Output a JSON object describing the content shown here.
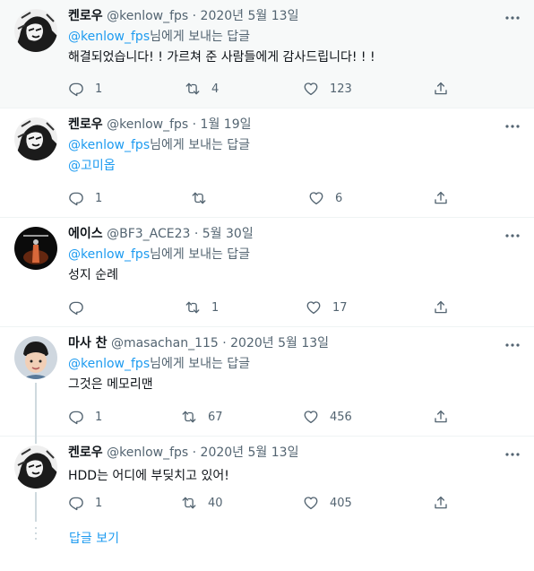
{
  "tweets": [
    {
      "name": "켄로우",
      "meta": "@kenlow_fps · 2020년 5월 13일",
      "reply_prefix": "@kenlow_fps",
      "reply_suffix": "님에게 보내는 답글",
      "text": "해결되었습니다! ! 가르쳐 준 사람들에게 감사드립니다! ! !",
      "replies": "1",
      "retweets": "4",
      "likes": "123"
    },
    {
      "name": "켄로우",
      "meta": "@kenlow_fps · 1월 19일",
      "reply_prefix": "@kenlow_fps",
      "reply_suffix": "님에게 보내는 답글",
      "text": "@고미옵",
      "replies": "1",
      "retweets": "",
      "likes": "6"
    },
    {
      "name": "에이스",
      "meta": "@BF3_ACE23 · 5월 30일",
      "reply_prefix": "@kenlow_fps",
      "reply_suffix": "님에게 보내는 답글",
      "text": "성지 순례",
      "replies": "",
      "retweets": "1",
      "likes": "17"
    },
    {
      "name": "마사 찬",
      "meta": "@masachan_115 · 2020년 5월 13일",
      "reply_prefix": "@kenlow_fps",
      "reply_suffix": "님에게 보내는 답글",
      "text": "그것은 메모리맨",
      "replies": "1",
      "retweets": "67",
      "likes": "456"
    },
    {
      "name": "켄로우",
      "meta": "@kenlow_fps · 2020년 5월 13일",
      "reply_prefix": "",
      "reply_suffix": "",
      "text": "HDD는 어디에 부딪치고 있어!",
      "replies": "1",
      "retweets": "40",
      "likes": "405"
    }
  ],
  "show_replies": "답글 보기",
  "colors": {
    "accent": "#1d9bf0",
    "secondary": "#536471",
    "highlight": "#f7f9f9"
  }
}
